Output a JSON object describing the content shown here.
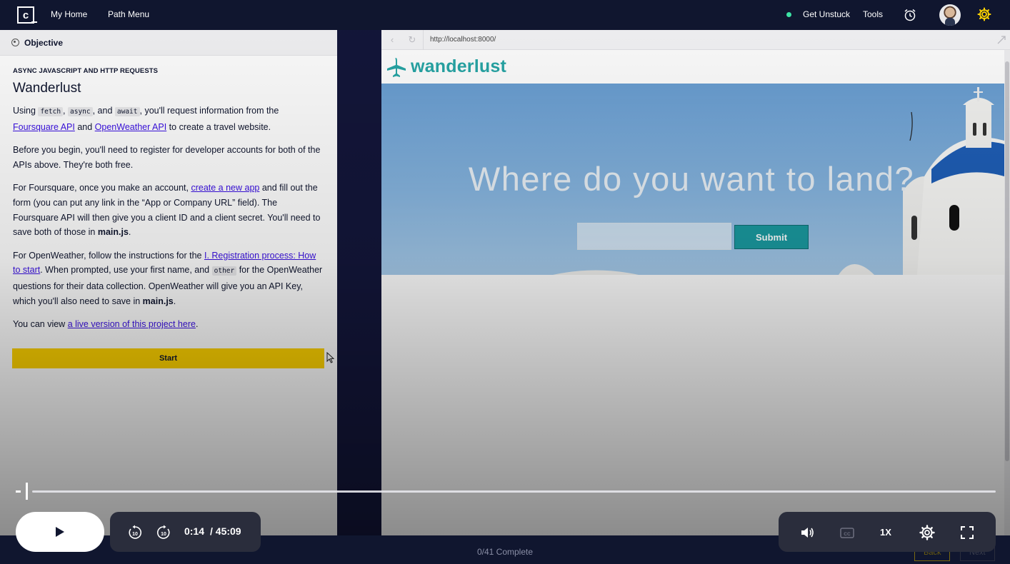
{
  "nav": {
    "logo": "c",
    "my_home": "My Home",
    "path_menu": "Path Menu",
    "get_unstuck": "Get Unstuck",
    "tools": "Tools"
  },
  "objective": {
    "header": "Objective",
    "eyebrow": "ASYNC JAVASCRIPT AND HTTP REQUESTS",
    "title": "Wanderlust",
    "p1_t1": "Using ",
    "code_fetch": "fetch",
    "p1_t2": ", ",
    "code_async": "async",
    "p1_t3": ", and ",
    "code_await": "await",
    "p1_t4": ", you'll request information from the ",
    "link_foursquare": "Foursquare API",
    "p1_t5": " and ",
    "link_openweather": "OpenWeather API",
    "p1_t6": " to create a travel website.",
    "p2": "Before you begin, you'll need to register for developer accounts for both of the APIs above. They're both free.",
    "p3_t1": "For Foursquare, once you make an account, ",
    "link_create_app": "create a new app",
    "p3_t2": " and fill out the form (you can put any link in the “App or Company URL” field). The Foursquare API will then give you a client ID and a client secret. You'll need to save both of those in ",
    "p3_bold": "main.js",
    "p3_t3": ".",
    "p4_t1": "For OpenWeather, follow the instructions for the ",
    "link_registration": "I. Registration process: How to start",
    "p4_t2": ". When prompted, use your first name, and ",
    "code_other": "other",
    "p4_t3": " for the OpenWeather questions for their data collection. OpenWeather will give you an API Key, which you'll also need to save in ",
    "p4_bold": "main.js",
    "p4_t4": ".",
    "p5_t1": "You can view ",
    "link_live": "a live version of this project here",
    "p5_t2": ".",
    "start_button": "Start"
  },
  "browser": {
    "url": "http://localhost:8000/",
    "brand": "wanderlust",
    "hero_title": "Where do you want to land?",
    "search_value": "",
    "submit_label": "Submit"
  },
  "footer": {
    "progress": "0/41 Complete",
    "back": "Back",
    "next": "Next"
  },
  "player": {
    "current_time": "0:14",
    "duration": "/ 45:09",
    "speed": "1X",
    "rewind_seconds": "10",
    "forward_seconds": "10",
    "progress_fraction": 0.005
  },
  "colors": {
    "nav_bg": "#10162f",
    "accent_yellow": "#ffd300",
    "brand_teal": "#27a6a6",
    "link": "#3a10e5",
    "status_green": "#3de3a4"
  }
}
